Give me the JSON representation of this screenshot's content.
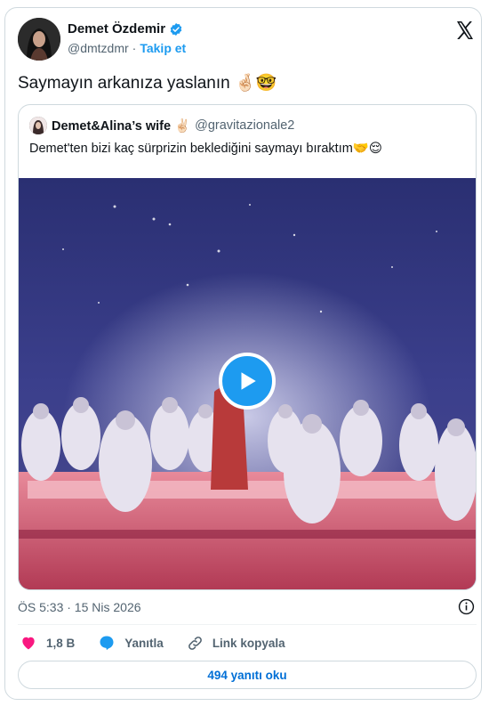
{
  "author": {
    "name": "Demet Özdemir",
    "handle": "@dmtzdmr",
    "separator": "·",
    "follow_label": "Takip et"
  },
  "tweet": {
    "text": "Saymayın arkanıza yaslanın 🤞🏻🤓"
  },
  "quoted": {
    "name": "Demet&Alina’s wife ✌🏻",
    "handle": "@gravitazionale2",
    "text": "Demet'ten bizi kaç sürprizin beklediğini saymayı bıraktım🤝😌"
  },
  "meta": {
    "timestamp": "ÖS 5:33 · 15 Nis 2026"
  },
  "actions": {
    "likes": "1,8 B",
    "reply_label": "Yanıtla",
    "copy_link_label": "Link kopyala"
  },
  "footer": {
    "read_replies_label": "494 yanıtı oku"
  },
  "colors": {
    "accent": "#1d9bf0",
    "like": "#f91880",
    "link": "#006fd6"
  }
}
